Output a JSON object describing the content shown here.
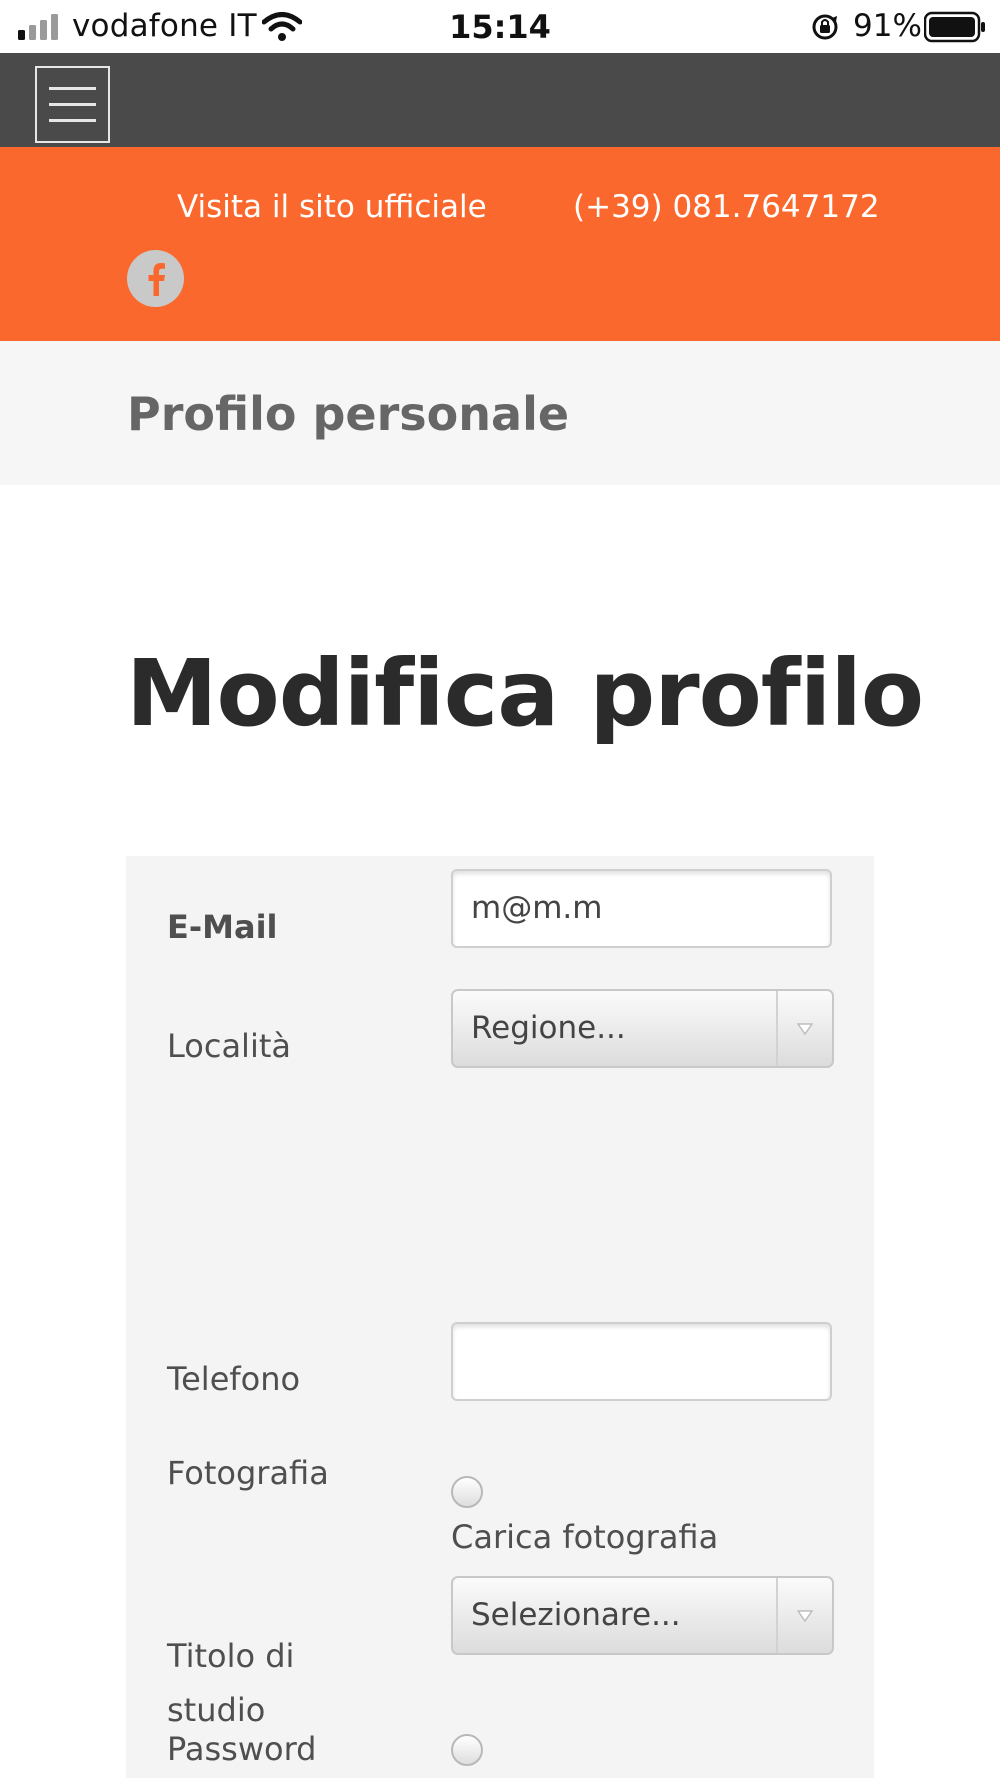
{
  "status_bar": {
    "carrier": "vodafone IT",
    "time": "15:14",
    "battery_percent": "91%",
    "battery_level": 0.91,
    "icons": [
      "signal-icon",
      "wifi-icon",
      "orientation-lock-icon",
      "battery-icon"
    ]
  },
  "navbar": {
    "menu_icon": "hamburger-menu-icon"
  },
  "topbar": {
    "official_site_link": "Visita il sito ufficiale",
    "phone": "(+39) 081.7647172",
    "social_icon": "facebook-icon",
    "accent_color": "#fb682d"
  },
  "page": {
    "title": "Profilo personale",
    "heading": "Modifica profilo"
  },
  "form": {
    "email": {
      "label": "E-Mail",
      "value": "m@m.m"
    },
    "location": {
      "label": "Località",
      "selected": "Regione..."
    },
    "phone": {
      "label": "Telefono",
      "value": ""
    },
    "photo": {
      "label": "Fotografia",
      "checkbox_caption": "Carica fotografia"
    },
    "education": {
      "label": "Titolo di studio",
      "selected": "Selezionare..."
    },
    "password": {
      "label": "Password"
    }
  }
}
